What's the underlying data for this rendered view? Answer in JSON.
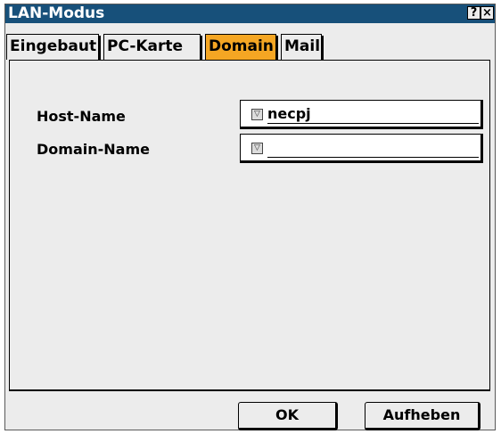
{
  "window": {
    "title": "LAN-Modus",
    "help_glyph": "?",
    "close_glyph": "×"
  },
  "tabs": [
    {
      "label": "Eingebaut",
      "active": false
    },
    {
      "label": "PC-Karte",
      "active": false
    },
    {
      "label": "Domain",
      "active": true
    },
    {
      "label": "Mail",
      "active": false
    }
  ],
  "form": {
    "host_name": {
      "label": "Host-Name",
      "value": "necpj"
    },
    "domain_name": {
      "label": "Domain-Name",
      "value": ""
    },
    "dropdown_glyph": "▽"
  },
  "buttons": {
    "ok": "OK",
    "cancel": "Aufheben"
  },
  "colors": {
    "title_bar": "#17507a",
    "active_tab": "#f5a623",
    "background": "#ececec"
  }
}
